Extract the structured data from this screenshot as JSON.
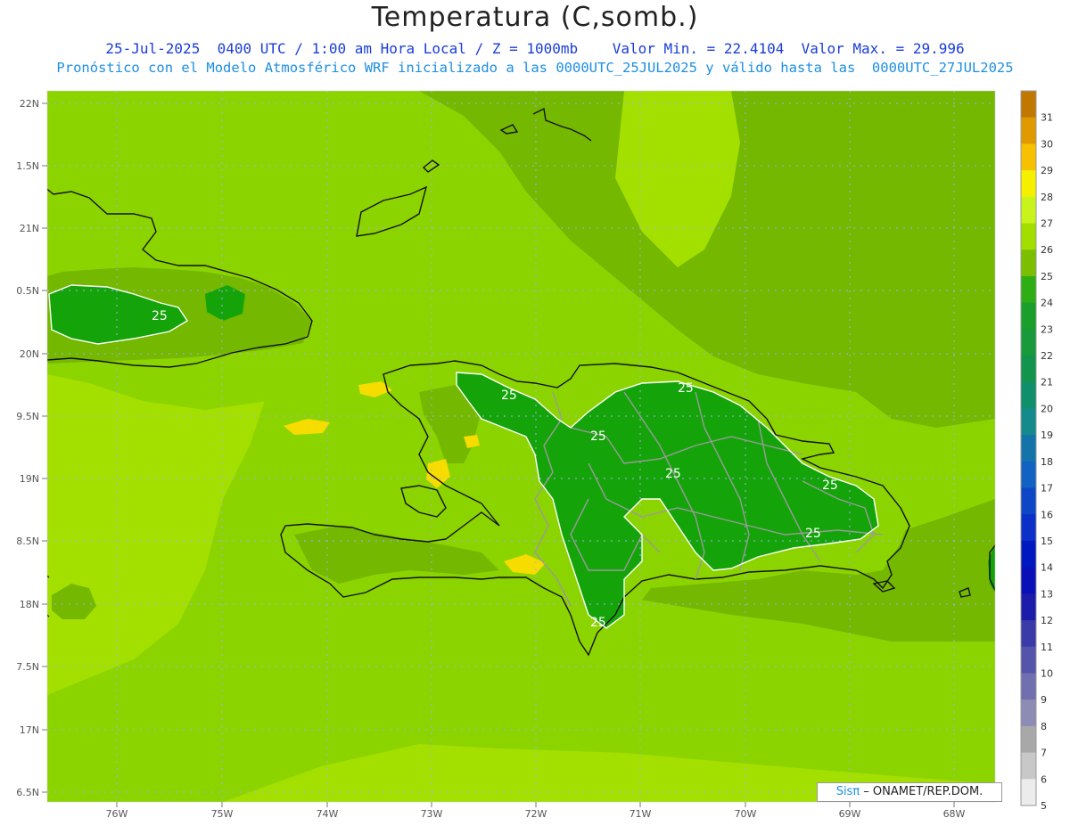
{
  "title": "Temperatura (C,somb.)",
  "subtitle_line1": "25-Jul-2025  0400 UTC / 1:00 am Hora Local / Z = 1000mb    Valor Min. = 22.4104  Valor Max. = 29.996",
  "subtitle_line2": "Pronóstico con el Modelo Atmosférico WRF inicializado a las 0000UTC_25JUL2025 y válido hasta las  0000UTC_27JUL2025",
  "credit": {
    "brand": "Sisπ",
    "text": " – ONAMET/REP.DOM."
  },
  "lat_labels": [
    "22N",
    "1.5N",
    "21N",
    "0.5N",
    "20N",
    "9.5N",
    "19N",
    "8.5N",
    "18N",
    "7.5N",
    "17N",
    "6.5N"
  ],
  "lon_labels": [
    "76W",
    "75W",
    "74W",
    "73W",
    "72W",
    "71W",
    "70W",
    "69W",
    "68W"
  ],
  "legend": {
    "labels": [
      "31",
      "30",
      "29",
      "28",
      "27",
      "26",
      "25",
      "24",
      "23",
      "22",
      "21",
      "20",
      "19",
      "18",
      "17",
      "16",
      "15",
      "14",
      "13",
      "12",
      "11",
      "10",
      "9",
      "8",
      "7",
      "6",
      "5"
    ],
    "colors": [
      "#c07800",
      "#e09a00",
      "#f7c000",
      "#f4f000",
      "#c9f41b",
      "#a2de00",
      "#7cbe00",
      "#2eae14",
      "#1a9e2c",
      "#189a3a",
      "#12944c",
      "#10906a",
      "#148a8c",
      "#1474aa",
      "#1262c4",
      "#0e46c8",
      "#0a30c8",
      "#0018c0",
      "#0a10b8",
      "#1c1caa",
      "#3a3aa8",
      "#5454aa",
      "#7070b0",
      "#8c8cb4",
      "#a8a8a8",
      "#c8c8c8",
      "#ececec"
    ]
  },
  "contour_labels": [
    "25",
    "25",
    "25",
    "25",
    "25",
    "25",
    "25",
    "25"
  ],
  "colors": {
    "bg_light": "#a3e000",
    "bg_mid": "#8cd400",
    "band_dark": "#74b800",
    "warm_yellow": "#f7dc00",
    "contour_green": "#14a40a",
    "coast": "#111111",
    "province": "#9a9a9a"
  }
}
